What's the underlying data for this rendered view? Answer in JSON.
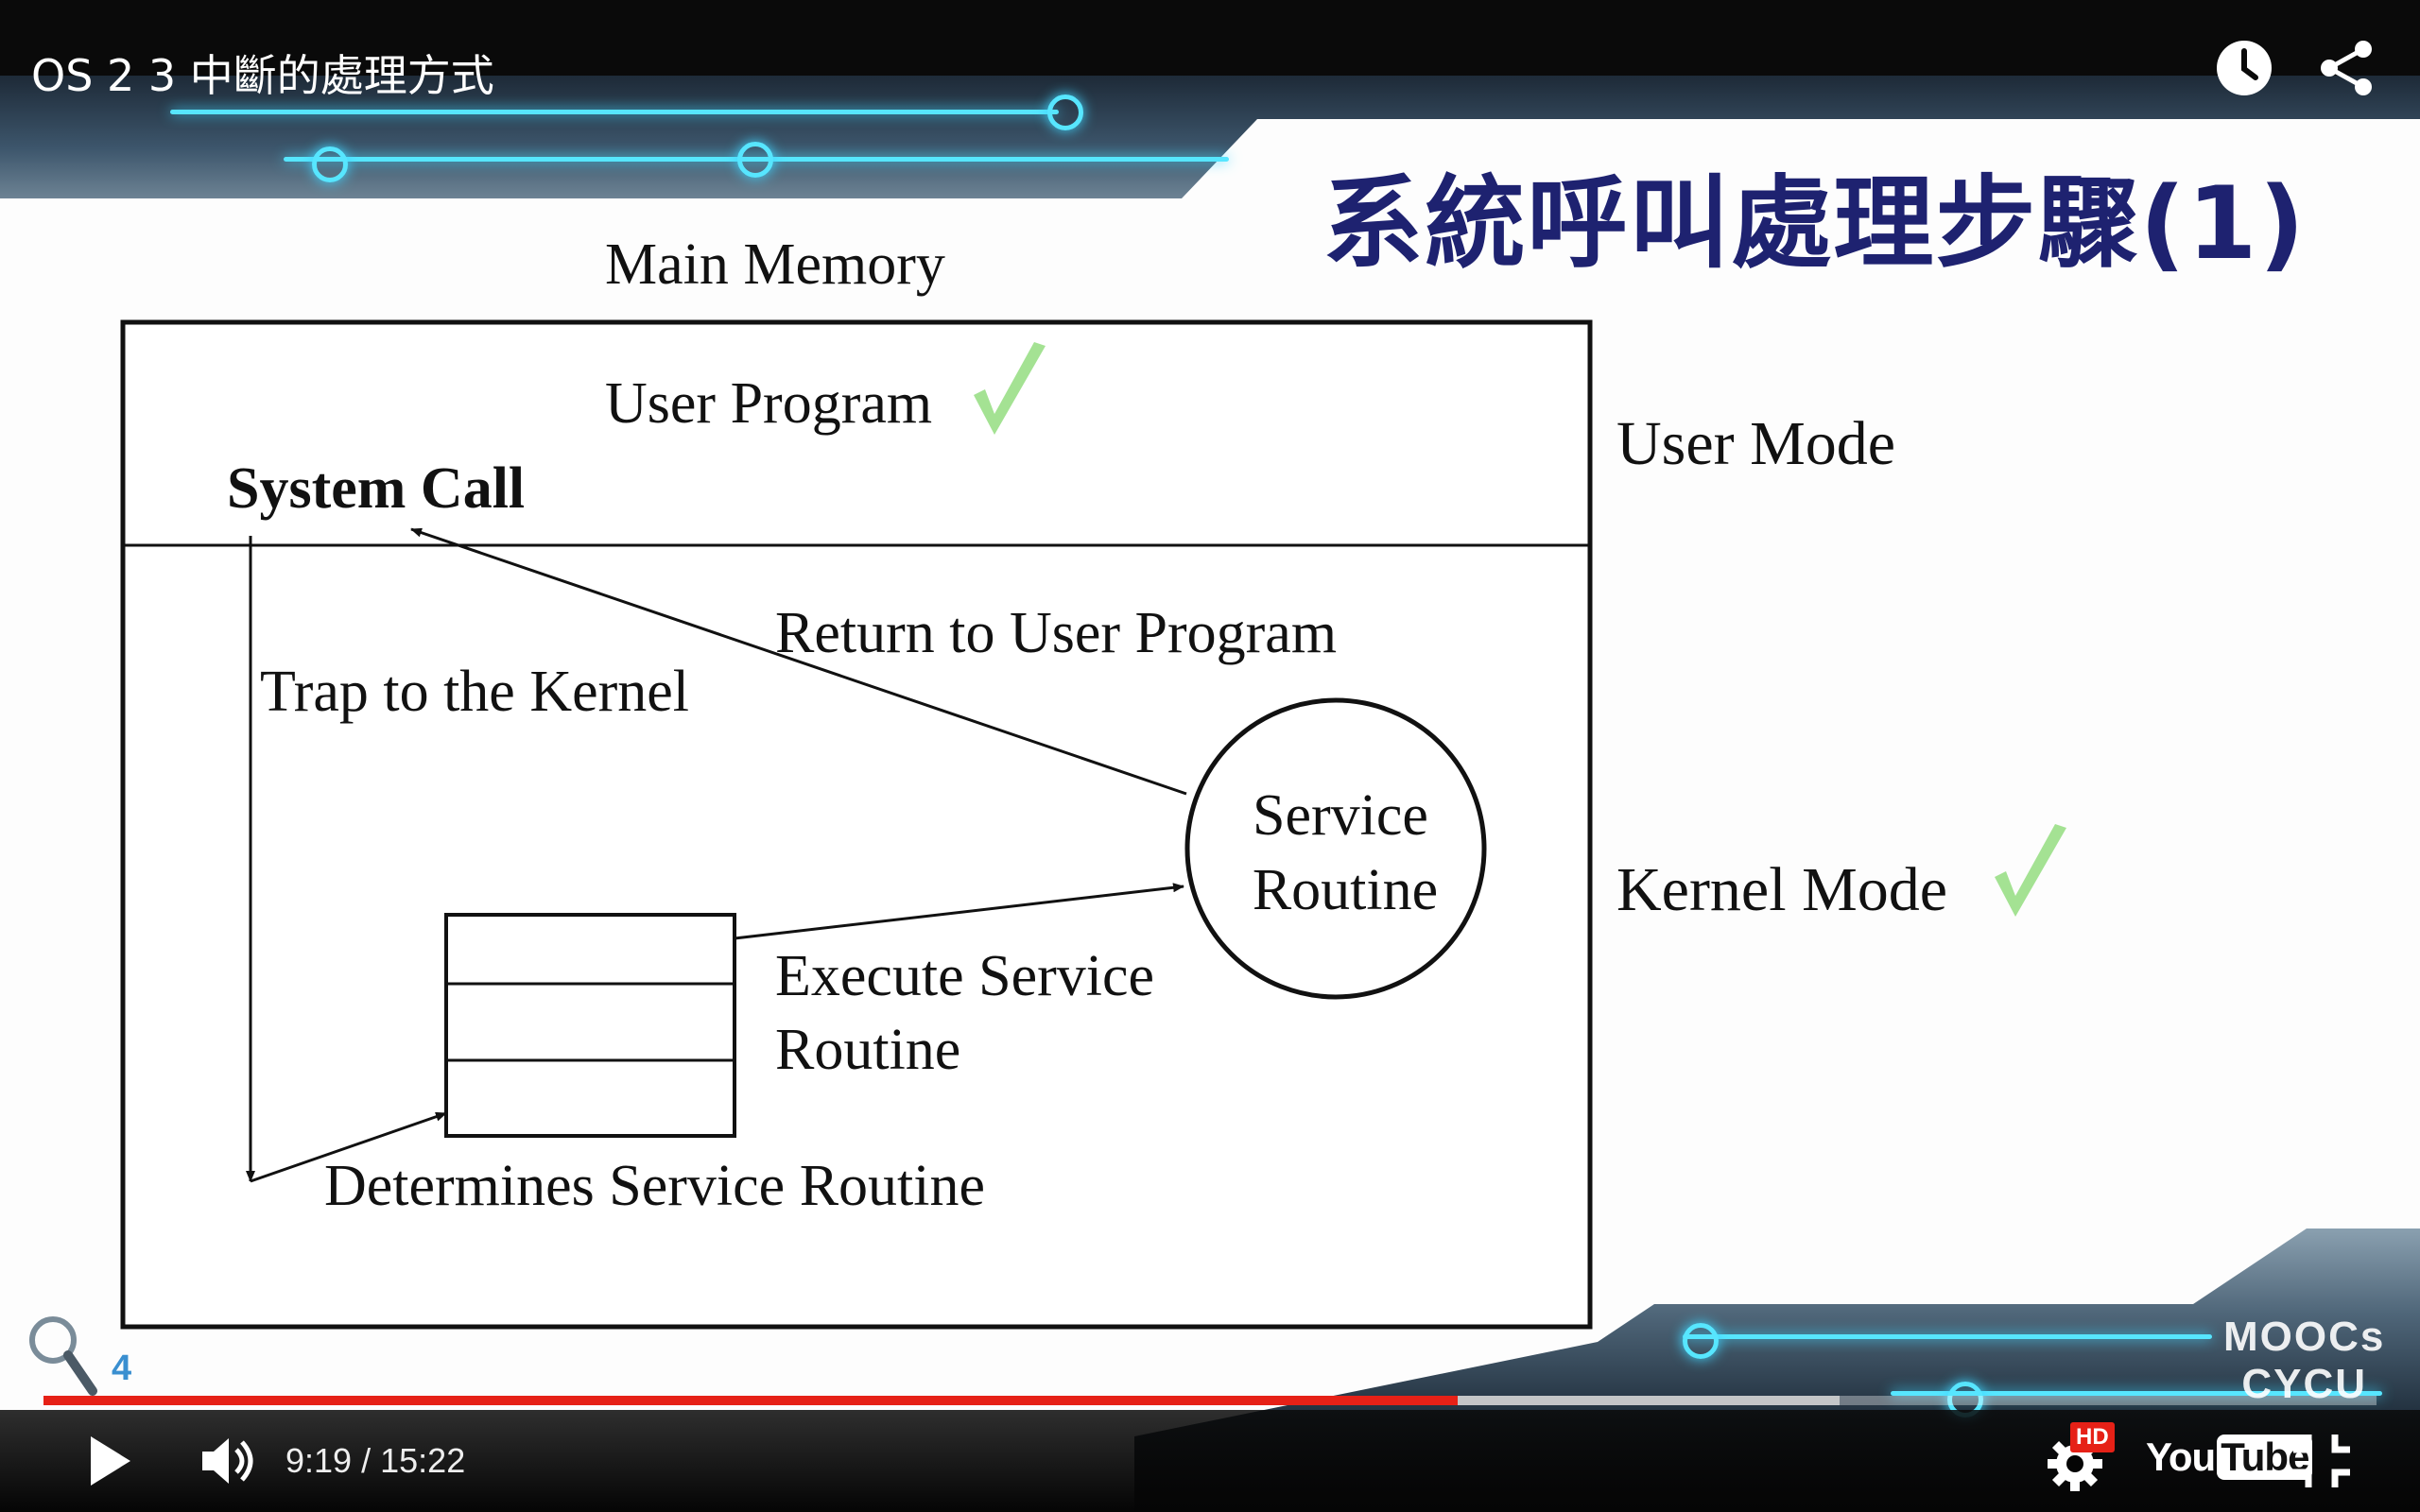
{
  "player": {
    "video_title": "OS 2 3 中斷的處理方式",
    "current_time": "9:19",
    "time_separator": "/",
    "duration": "15:22",
    "played_fraction": 0.606,
    "buffered_fraction": 0.77,
    "hd_badge": "HD",
    "youtube_logo_text": "You",
    "youtube_logo_tube": "Tube",
    "icons": {
      "watch_later": "clock-icon",
      "share": "share-icon",
      "play": "play-icon",
      "volume": "volume-icon",
      "settings": "gear-icon",
      "exit_fullscreen": "exit-fullscreen-icon"
    },
    "colors": {
      "progress": "#e62117",
      "accent": "#e62117"
    }
  },
  "slide": {
    "title": "系統呼叫處理步驟(1)",
    "page_number": "4",
    "logo_line1": "MOOCs",
    "logo_line2": "CYCU",
    "title_color": "#1e2270",
    "check_color": "#9fe08d"
  },
  "diagram": {
    "memory_label": "Main Memory",
    "user_program": "User Program",
    "system_call": "System Call",
    "return_label": "Return to User Program",
    "trap_label": "Trap to the Kernel",
    "service_line1": "Service",
    "service_line2": "Routine",
    "execute_line1": "Execute Service",
    "execute_line2": "Routine",
    "determines_label": "Determines Service Routine",
    "user_mode": "User Mode",
    "kernel_mode": "Kernel Mode"
  }
}
